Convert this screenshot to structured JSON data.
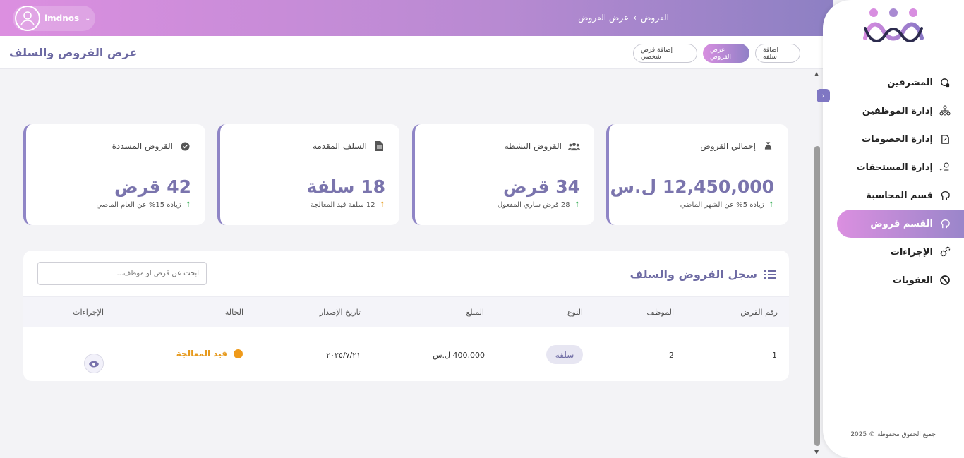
{
  "header": {
    "username": "imdnos",
    "breadcrumb": [
      "القروض",
      "عرض القروض"
    ],
    "breadcrumb_separator": "›"
  },
  "subheader": {
    "page_title": "عرض القروض والسلف",
    "tabs": [
      {
        "label": "اضافة سلفه",
        "active": false
      },
      {
        "label": "عرض القروض",
        "active": true
      },
      {
        "label": "إضافة قرض شخصي",
        "active": false
      }
    ]
  },
  "sidebar": {
    "items": [
      {
        "label": "المشرفين",
        "icon": "user-shield-icon"
      },
      {
        "label": "إدارة الموظفين",
        "icon": "org-chart-icon"
      },
      {
        "label": "إدارة الخصومات",
        "icon": "discount-icon"
      },
      {
        "label": "إدارة المستحقات",
        "icon": "money-hand-icon"
      },
      {
        "label": "قسم المحاسبة",
        "icon": "brain-icon"
      },
      {
        "label": "القسم قروض",
        "icon": "brain-icon",
        "active": true
      },
      {
        "label": "الإجراءات",
        "icon": "gears-icon"
      },
      {
        "label": "العقوبات",
        "icon": "ban-icon"
      }
    ],
    "footer": "جميع الحقوق محفوظة © 2025"
  },
  "stats": [
    {
      "title": "إجمالي القروض",
      "value": "12,450,000 ل.س",
      "sub": "زيادة 5% عن الشهر الماضي",
      "trend": "up-green",
      "icon": "money-bag-icon"
    },
    {
      "title": "القروض النشطة",
      "value": "34 قرض",
      "sub": "28 قرض ساري المفعول",
      "trend": "up-green",
      "icon": "users-icon"
    },
    {
      "title": "السلف المقدمة",
      "value": "18 سلفة",
      "sub": "12 سلفة قيد المعالجة",
      "trend": "up-orange",
      "icon": "file-icon"
    },
    {
      "title": "القروض المسددة",
      "value": "42 قرض",
      "sub": "زيادة 15% عن العام الماضي",
      "trend": "up-green",
      "icon": "check-circle-icon"
    }
  ],
  "table": {
    "title": "سجل القروض والسلف",
    "search_placeholder": "ابحث عن قرض أو موظف...",
    "columns": [
      "رقم القرض",
      "الموظف",
      "النوع",
      "المبلغ",
      "تاريخ الإصدار",
      "الحالة",
      "الإجراءات"
    ],
    "rows": [
      {
        "id": "1",
        "employee": "2",
        "type": "سلفة",
        "amount": "400,000 ل.س",
        "date": "٢٠٢٥/٧/٢١",
        "status": "قيد المعالجة"
      }
    ]
  },
  "colors": {
    "accent": "#7a74ad",
    "gradient_start": "#dc8fe0",
    "gradient_end": "#8d80c3",
    "pending": "#ef9a1a",
    "up": "#2aa84a"
  }
}
